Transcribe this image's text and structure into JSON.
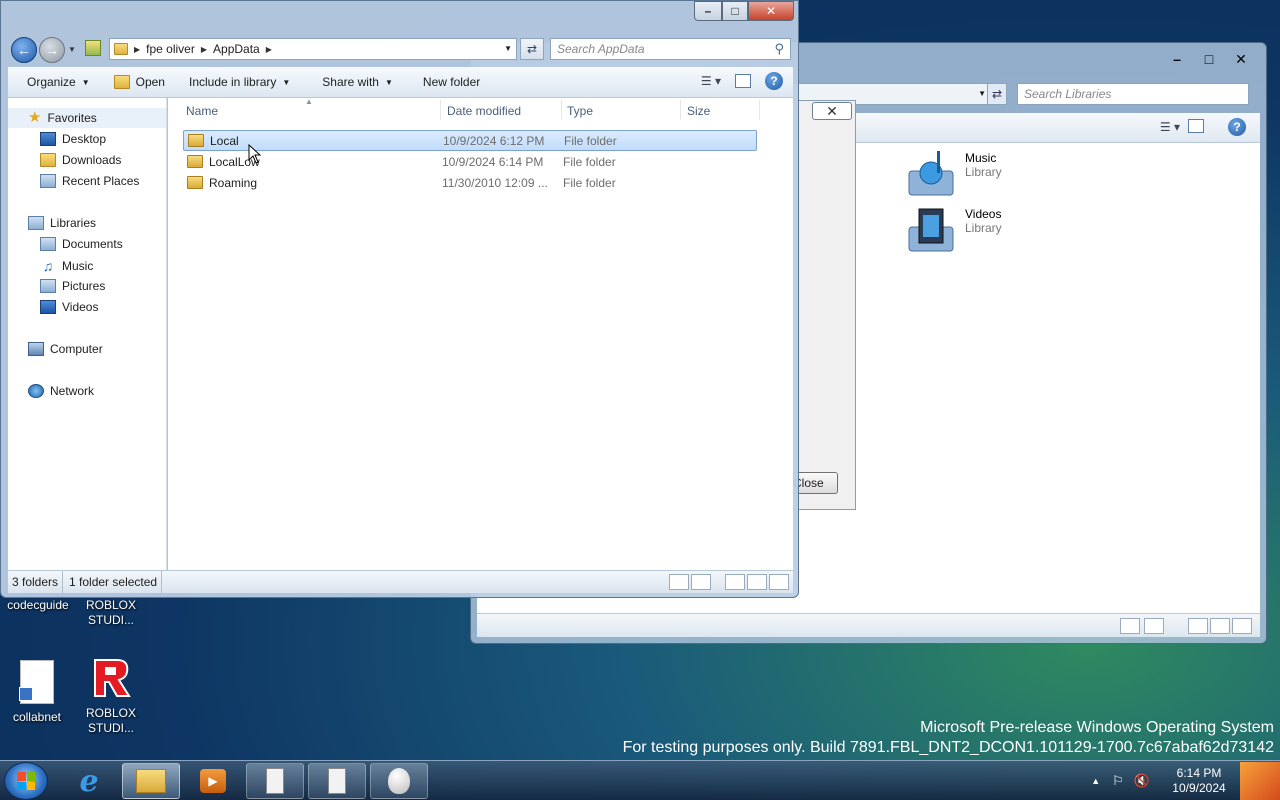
{
  "desktop": {
    "icons": [
      {
        "label": "codecguide"
      },
      {
        "label": "ROBLOX STUDI..."
      },
      {
        "label": "collabnet"
      },
      {
        "label": "ROBLOX STUDI..."
      }
    ],
    "watermark_line1": "Microsoft Pre-release Windows Operating System",
    "watermark_line2": "For testing purposes only. Build 7891.FBL_DNT2_DCON1.101129-1700.7c67abaf62d73142"
  },
  "bg_window": {
    "search_placeholder": "Search Libraries",
    "libraries": [
      {
        "name": "Music",
        "sub": "Library",
        "icon": "music-library-icon"
      },
      {
        "name": "Videos",
        "sub": "Library",
        "icon": "videos-library-icon"
      }
    ]
  },
  "dialog": {
    "button_label": "Close"
  },
  "explorer": {
    "address": {
      "segments": [
        "fpe oliver",
        "AppData"
      ]
    },
    "search_placeholder": "Search AppData",
    "toolbar": {
      "organize": "Organize",
      "open": "Open",
      "include_in_library": "Include in library",
      "share_with": "Share with",
      "new_folder": "New folder"
    },
    "nav": {
      "favorites": "Favorites",
      "desktop": "Desktop",
      "downloads": "Downloads",
      "recent_places": "Recent Places",
      "libraries": "Libraries",
      "documents": "Documents",
      "music": "Music",
      "pictures": "Pictures",
      "videos": "Videos",
      "computer": "Computer",
      "network": "Network"
    },
    "columns": {
      "name": "Name",
      "date_modified": "Date modified",
      "type": "Type",
      "size": "Size"
    },
    "files": [
      {
        "name": "Local",
        "date": "10/9/2024 6:12 PM",
        "type": "File folder",
        "selected": true
      },
      {
        "name": "LocalLow",
        "date": "10/9/2024 6:14 PM",
        "type": "File folder",
        "selected": false
      },
      {
        "name": "Roaming",
        "date": "11/30/2010 12:09 ...",
        "type": "File folder",
        "selected": false
      }
    ],
    "status": {
      "count": "3 folders",
      "selection": "1 folder selected"
    }
  },
  "taskbar": {
    "time": "6:14 PM",
    "date": "10/9/2024"
  }
}
